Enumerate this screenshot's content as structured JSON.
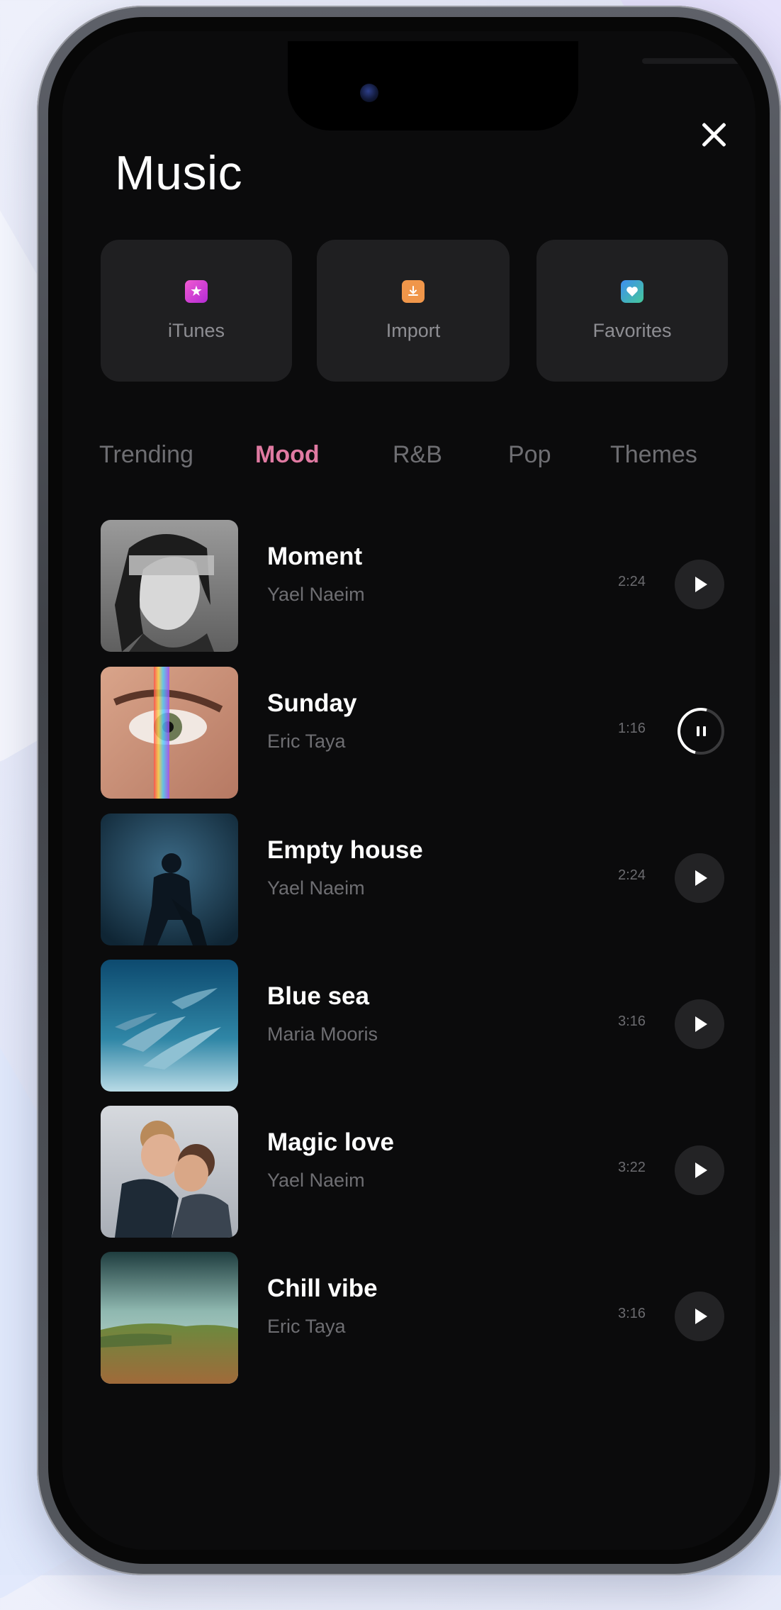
{
  "header": {
    "title": "Music"
  },
  "shortcuts": [
    {
      "label": "iTunes",
      "icon": "star-icon"
    },
    {
      "label": "Import",
      "icon": "download-icon"
    },
    {
      "label": "Favorites",
      "icon": "heart-icon"
    }
  ],
  "tabs": [
    {
      "label": "Trending",
      "active": false
    },
    {
      "label": "Mood",
      "active": true
    },
    {
      "label": "R&B",
      "active": false
    },
    {
      "label": "Pop",
      "active": false
    },
    {
      "label": "Themes",
      "active": false
    }
  ],
  "tracks": [
    {
      "title": "Moment",
      "artist": "Yael Naeim",
      "duration": "2:24",
      "state": "play"
    },
    {
      "title": "Sunday",
      "artist": "Eric Taya",
      "duration": "1:16",
      "state": "pause"
    },
    {
      "title": "Empty house",
      "artist": "Yael Naeim",
      "duration": "2:24",
      "state": "play"
    },
    {
      "title": "Blue sea",
      "artist": "Maria Mooris",
      "duration": "3:16",
      "state": "play"
    },
    {
      "title": "Magic love",
      "artist": "Yael Naeim",
      "duration": "3:22",
      "state": "play"
    },
    {
      "title": "Chill vibe",
      "artist": "Eric Taya",
      "duration": "3:16",
      "state": "play"
    }
  ],
  "colors": {
    "accent": "#e07aa2",
    "screen": "#0b0b0c",
    "tile": "#1f1f21"
  }
}
